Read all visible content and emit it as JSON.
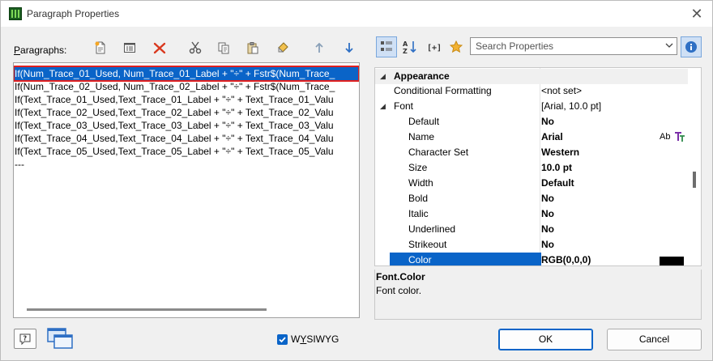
{
  "window": {
    "title": "Paragraph Properties"
  },
  "left": {
    "label_prefix": "",
    "label_underlined": "P",
    "label_rest": "aragraphs:",
    "toolbar_icons": [
      "new-paragraph-icon",
      "properties-icon",
      "delete-icon",
      "cut-icon",
      "copy-icon",
      "paste-icon",
      "clear-icon",
      "move-up-icon",
      "move-down-icon"
    ],
    "rows": [
      "If(Num_Trace_01_Used, Num_Trace_01_Label + \"÷\" + Fstr$(Num_Trace_",
      "If(Num_Trace_02_Used, Num_Trace_02_Label + \"÷\" + Fstr$(Num_Trace_",
      "If(Text_Trace_01_Used,Text_Trace_01_Label + \"÷\" + Text_Trace_01_Valu",
      "If(Text_Trace_02_Used,Text_Trace_02_Label + \"÷\" + Text_Trace_02_Valu",
      "If(Text_Trace_03_Used,Text_Trace_03_Label + \"÷\" + Text_Trace_03_Valu",
      "If(Text_Trace_04_Used,Text_Trace_04_Label + \"÷\" + Text_Trace_04_Valu",
      "If(Text_Trace_05_Used,Text_Trace_05_Label + \"÷\" + Text_Trace_05_Valu",
      "---"
    ]
  },
  "props": {
    "search_placeholder": "Search Properties",
    "category_appearance": "Appearance",
    "rows": [
      {
        "name": "Conditional Formatting",
        "value": "<not set>",
        "indent": 1,
        "bold": false
      },
      {
        "name": "Font",
        "value": "[Arial, 10.0 pt]",
        "indent": 1,
        "bold": false,
        "expander": "◢"
      },
      {
        "name": "Default",
        "value": "No",
        "indent": 2,
        "bold": true
      },
      {
        "name": "Name",
        "value": "Arial",
        "indent": 2,
        "bold": true
      },
      {
        "name": "Character Set",
        "value": "Western",
        "indent": 2,
        "bold": true
      },
      {
        "name": "Size",
        "value": "10.0 pt",
        "indent": 2,
        "bold": true
      },
      {
        "name": "Width",
        "value": "Default",
        "indent": 2,
        "bold": true
      },
      {
        "name": "Bold",
        "value": "No",
        "indent": 2,
        "bold": true
      },
      {
        "name": "Italic",
        "value": "No",
        "indent": 2,
        "bold": true
      },
      {
        "name": "Underlined",
        "value": "No",
        "indent": 2,
        "bold": true
      },
      {
        "name": "Strikeout",
        "value": "No",
        "indent": 2,
        "bold": true
      },
      {
        "name": "Color",
        "value": "RGB(0,0,0)",
        "indent": 2,
        "bold": true,
        "selected": true
      }
    ],
    "font_preview": "Ab",
    "color_swatch": "#000000",
    "desc_title": "Font.Color",
    "desc_text": "Font color."
  },
  "footer": {
    "wysiwyg_prefix": "W",
    "wysiwyg_underlined": "Y",
    "wysiwyg_rest": "SIWYG",
    "ok": "OK",
    "cancel": "Cancel"
  },
  "colors": {
    "accent": "#0a64c8",
    "selection_border": "#e02020"
  }
}
